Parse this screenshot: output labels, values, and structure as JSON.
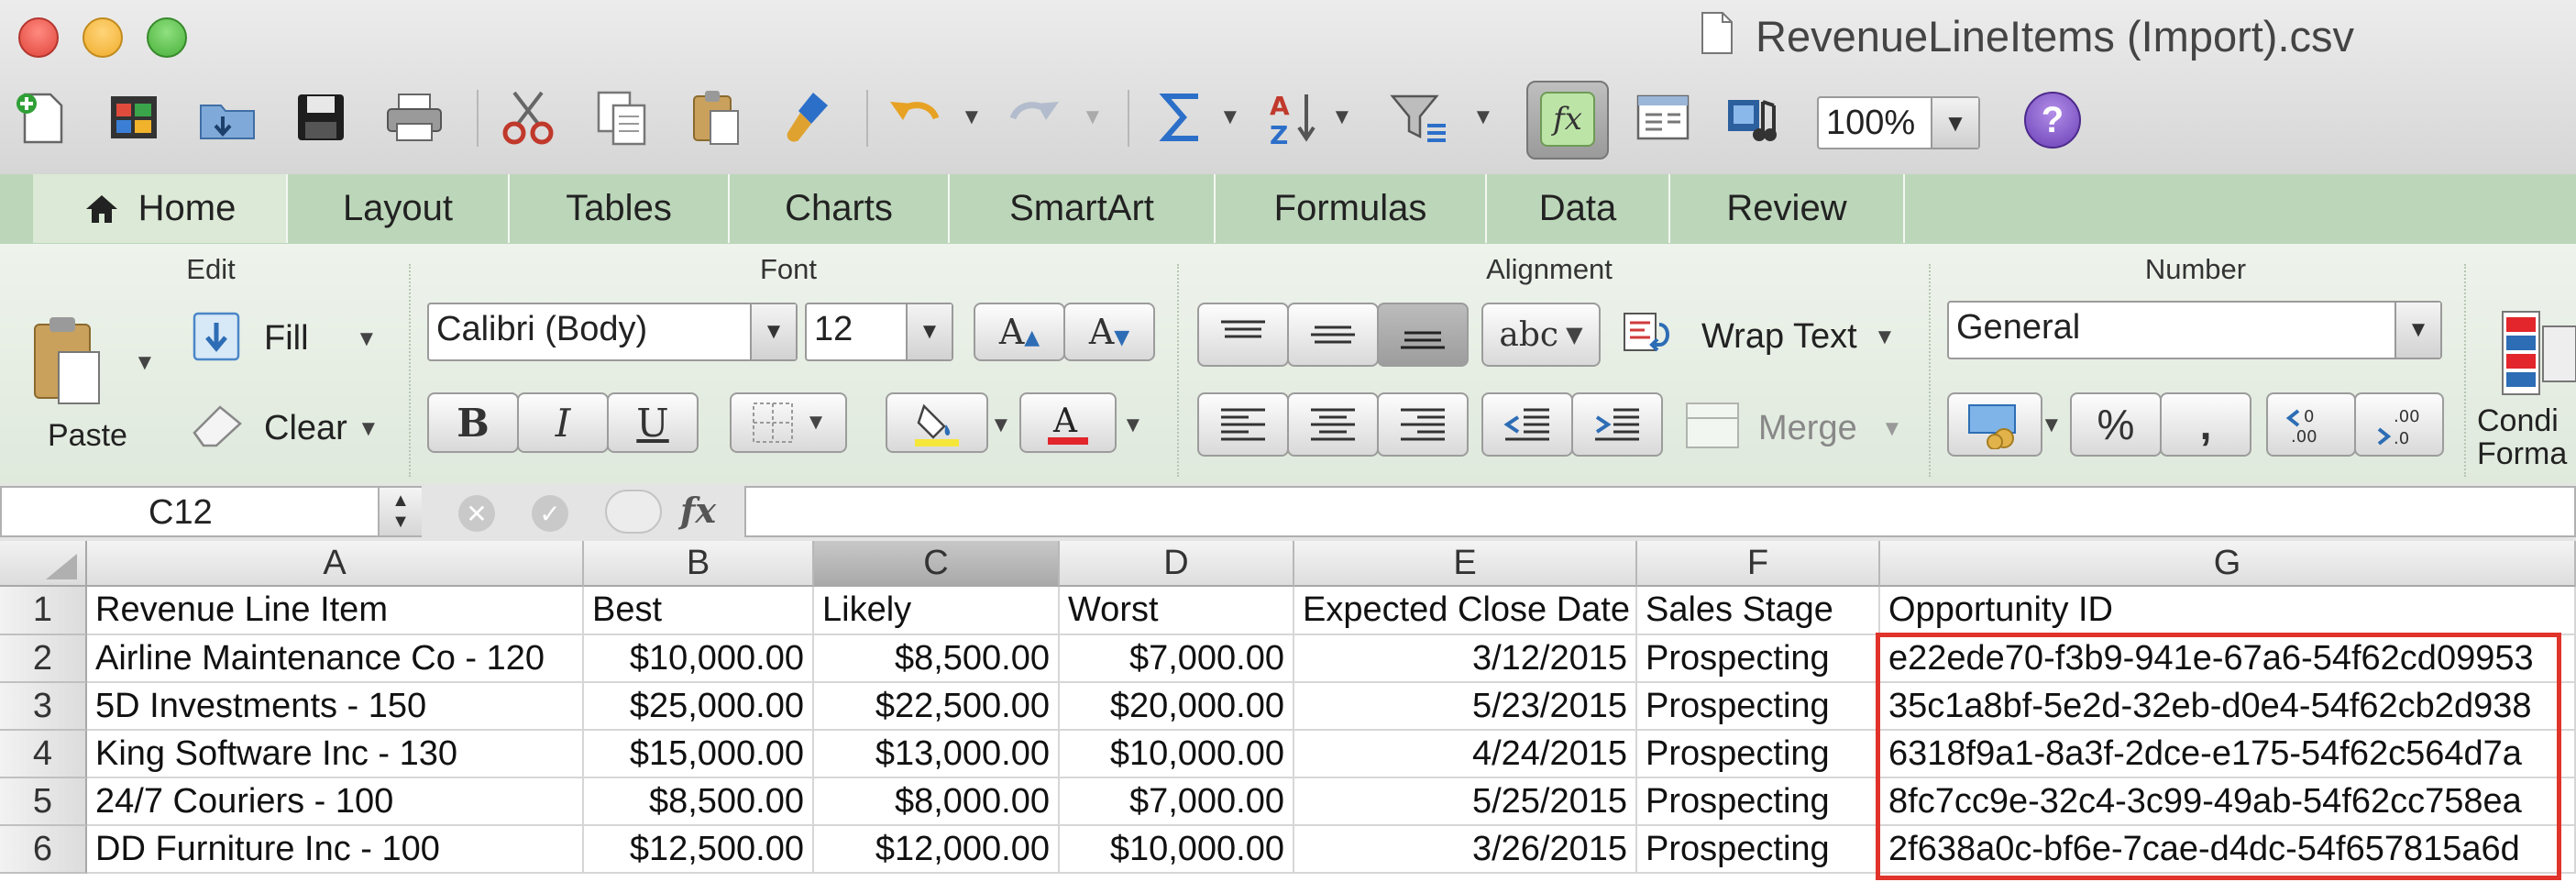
{
  "window": {
    "title": "RevenueLineItems (Import).csv"
  },
  "toolbar": {
    "zoom": "100%"
  },
  "ribbon_tabs": [
    "Home",
    "Layout",
    "Tables",
    "Charts",
    "SmartArt",
    "Formulas",
    "Data",
    "Review"
  ],
  "ribbon": {
    "edit": {
      "group": "Edit",
      "paste": "Paste",
      "fill": "Fill",
      "clear": "Clear"
    },
    "font": {
      "group": "Font",
      "name": "Calibri (Body)",
      "size": "12",
      "bold": "B",
      "italic": "I",
      "underline": "U"
    },
    "alignment": {
      "group": "Alignment",
      "abc": "abc",
      "wrap_text": "Wrap Text",
      "merge": "Merge"
    },
    "number": {
      "group": "Number",
      "format": "General"
    },
    "format": {
      "label_top": "Condi",
      "label_bottom": "Forma"
    }
  },
  "formula_bar": {
    "cell_ref": "C12",
    "fx": "fx",
    "value": ""
  },
  "grid": {
    "columns": [
      "A",
      "B",
      "C",
      "D",
      "E",
      "F",
      "G"
    ],
    "selected_column": "C",
    "rows": [
      {
        "n": "1",
        "cells": [
          "Revenue Line Item",
          "Best",
          "Likely",
          "Worst",
          "Expected Close Date",
          "Sales Stage",
          "Opportunity ID"
        ]
      },
      {
        "n": "2",
        "cells": [
          "Airline Maintenance Co - 120",
          "$10,000.00",
          "$8,500.00",
          "$7,000.00",
          "3/12/2015",
          "Prospecting",
          "e22ede70-f3b9-941e-67a6-54f62cd09953"
        ]
      },
      {
        "n": "3",
        "cells": [
          "5D Investments - 150",
          "$25,000.00",
          "$22,500.00",
          "$20,000.00",
          "5/23/2015",
          "Prospecting",
          "35c1a8bf-5e2d-32eb-d0e4-54f62cb2d938"
        ]
      },
      {
        "n": "4",
        "cells": [
          "King Software Inc - 130",
          "$15,000.00",
          "$13,000.00",
          "$10,000.00",
          "4/24/2015",
          "Prospecting",
          "6318f9a1-8a3f-2dce-e175-54f62c564d7a"
        ]
      },
      {
        "n": "5",
        "cells": [
          "24/7 Couriers - 100",
          "$8,500.00",
          "$8,000.00",
          "$7,000.00",
          "5/25/2015",
          "Prospecting",
          "8fc7cc9e-32c4-3c99-49ab-54f62cc758ea"
        ]
      },
      {
        "n": "6",
        "cells": [
          "DD Furniture Inc - 100",
          "$12,500.00",
          "$12,000.00",
          "$10,000.00",
          "3/26/2015",
          "Prospecting",
          "2f638a0c-bf6e-7cae-d4dc-54f657815a6d"
        ]
      }
    ]
  },
  "colors": {
    "ribbon_green": "#bcd6b9",
    "highlight_red": "#e0332a",
    "close": "#ee5b52",
    "minimize": "#f7be3b",
    "zoom": "#5fc04f"
  },
  "icons": [
    "new-workbook-icon",
    "templates-icon",
    "open-icon",
    "save-icon",
    "print-icon",
    "cut-icon",
    "copy-icon",
    "paste-icon",
    "format-painter-icon",
    "undo-icon",
    "redo-icon",
    "autosum-icon",
    "sort-icon",
    "filter-icon",
    "formula-builder-icon",
    "show-toolbox-icon",
    "media-browser-icon",
    "help-icon"
  ]
}
